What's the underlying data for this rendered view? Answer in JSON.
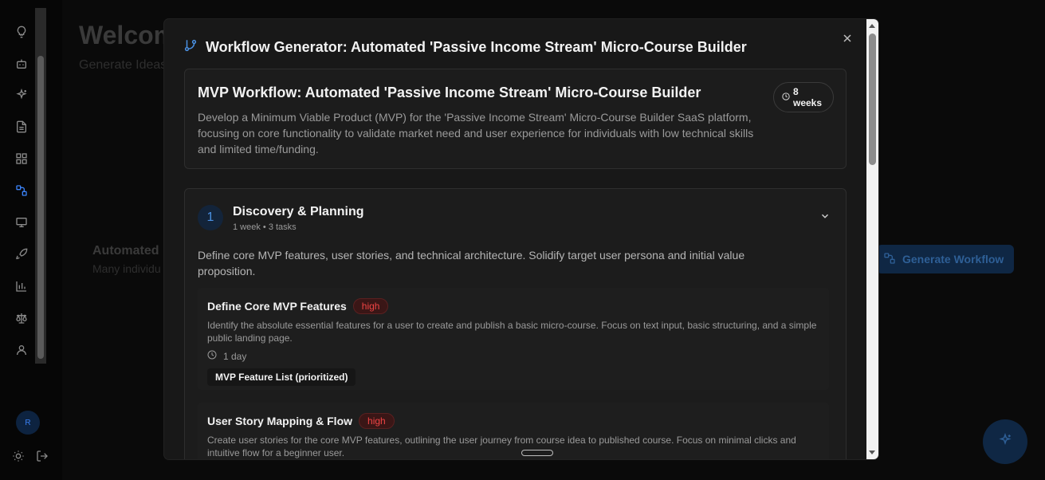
{
  "background": {
    "title": "Welcom",
    "subtitle": "Generate Ideas",
    "card_title": "Automated",
    "card_subtitle": "Many individu",
    "generate_button": "Generate Workflow"
  },
  "sidebar": {
    "icons": [
      "lightbulb-icon",
      "bot-icon",
      "sparkles-icon",
      "document-icon",
      "grid-icon",
      "workflow-icon",
      "presentation-icon",
      "rocket-icon",
      "bar-chart-icon",
      "scale-icon",
      "user-icon"
    ],
    "active": "workflow-icon",
    "avatar_initial": "R",
    "bottom_icons": [
      "sun-icon",
      "logout-icon"
    ]
  },
  "modal": {
    "title": "Workflow Generator: Automated 'Passive Income Stream' Micro-Course Builder",
    "summary": {
      "title": "MVP Workflow: Automated 'Passive Income Stream' Micro-Course Builder",
      "description": "Develop a Minimum Viable Product (MVP) for the 'Passive Income Stream' Micro-Course Builder SaaS platform, focusing on core functionality to validate market need and user experience for individuals with low technical skills and limited time/funding.",
      "duration": "8 weeks"
    },
    "phase": {
      "number": "1",
      "title": "Discovery & Planning",
      "meta": "1 week • 3 tasks",
      "description": "Define core MVP features, user stories, and technical architecture. Solidify target user persona and initial value proposition.",
      "tasks": [
        {
          "title": "Define Core MVP Features",
          "priority": "high",
          "description": "Identify the absolute essential features for a user to create and publish a basic micro-course. Focus on text input, basic structuring, and a simple public landing page.",
          "duration": "1 day",
          "deliverable": "MVP Feature List (prioritized)"
        },
        {
          "title": "User Story Mapping & Flow",
          "priority": "high",
          "description": "Create user stories for the core MVP features, outlining the user journey from course idea to published course. Focus on minimal clicks and intuitive flow for a beginner user."
        }
      ]
    }
  },
  "colors": {
    "accent": "#4a90e2",
    "priority_high": "#ef4444",
    "modal_bg": "#181818"
  }
}
